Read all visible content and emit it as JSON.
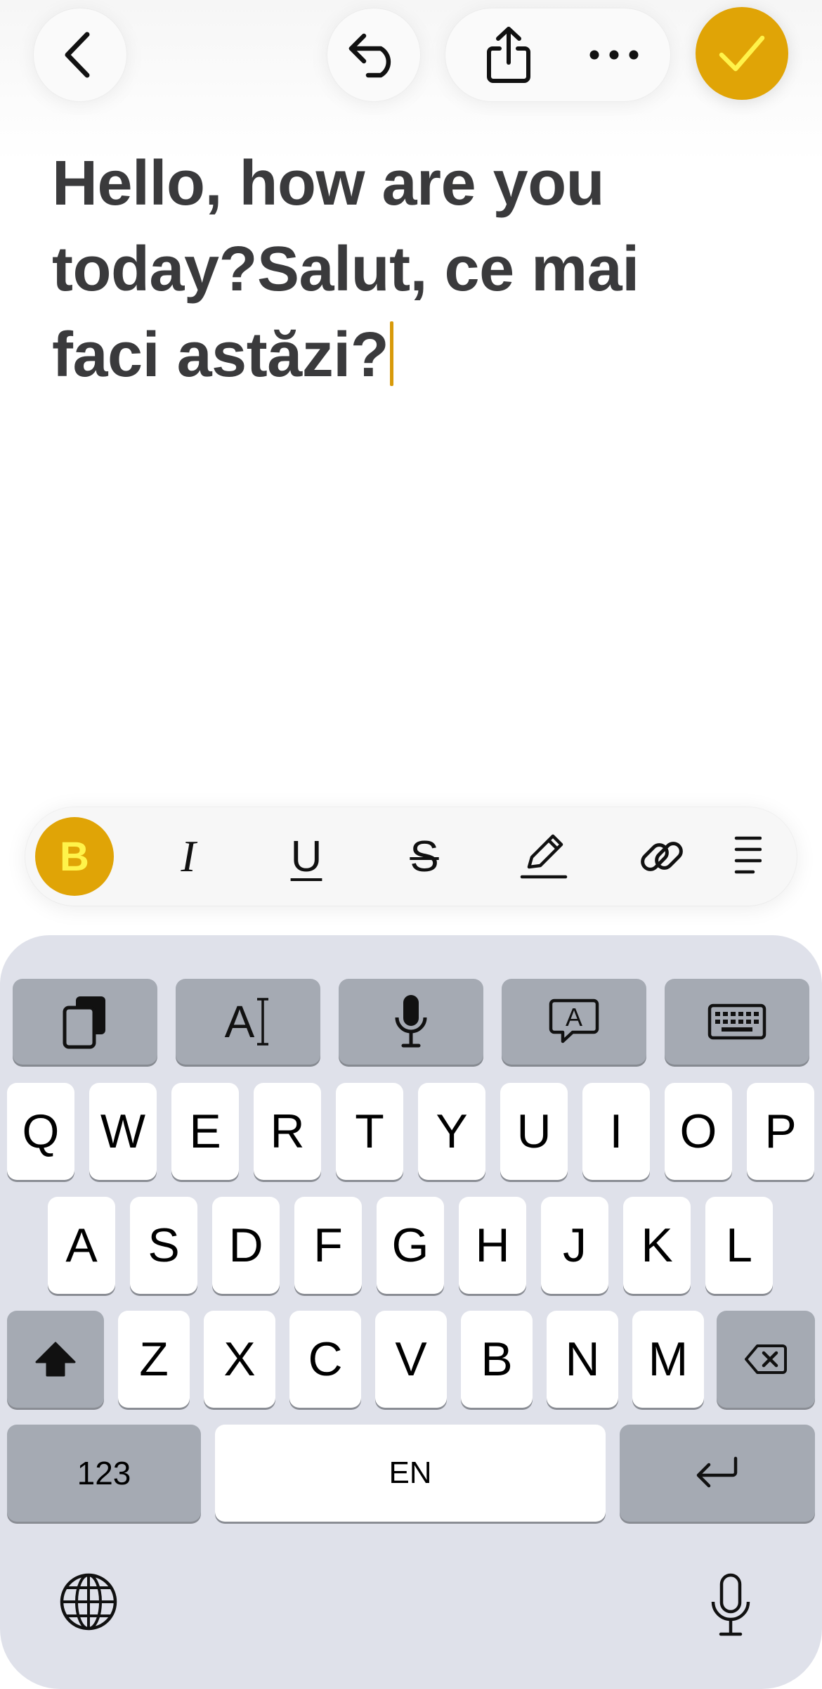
{
  "colors": {
    "accent": "#e0a406",
    "accent_text": "#fff34a",
    "keyboard_bg": "#dfe1ea",
    "key_light": "#ffffff",
    "key_dark": "#a5aab3",
    "note_text": "#3a3a3c"
  },
  "toolbar": {
    "back_icon": "chevron-left-icon",
    "undo_icon": "undo-arrow-icon",
    "share_icon": "share-icon",
    "more_icon": "ellipsis-icon",
    "done_icon": "checkmark-icon"
  },
  "note": {
    "text": "Hello, how are you today?Salut, ce mai faci astăzi?"
  },
  "format_bar": {
    "bold_label": "B",
    "italic_label": "I",
    "underline_label": "U",
    "strike_label": "S",
    "icons": [
      "bold-icon",
      "italic-icon",
      "underline-icon",
      "strikethrough-icon",
      "highlight-pen-icon",
      "link-icon",
      "list-icon"
    ]
  },
  "keyboard": {
    "tools": [
      "clipboard-icon",
      "text-cursor-icon",
      "microphone-icon",
      "translate-bubble-icon",
      "keyboard-icon"
    ],
    "tool_cursor_label": "A",
    "tool_bubble_label": "A",
    "row1": [
      "Q",
      "W",
      "E",
      "R",
      "T",
      "Y",
      "U",
      "I",
      "O",
      "P"
    ],
    "row2": [
      "A",
      "S",
      "D",
      "F",
      "G",
      "H",
      "J",
      "K",
      "L"
    ],
    "row3": [
      "Z",
      "X",
      "C",
      "V",
      "B",
      "N",
      "M"
    ],
    "numbers_label": "123",
    "space_label": "EN",
    "shift_icon": "shift-icon",
    "backspace_icon": "backspace-icon",
    "return_icon": "return-icon",
    "globe_icon": "globe-icon",
    "dictation_icon": "microphone-icon"
  }
}
